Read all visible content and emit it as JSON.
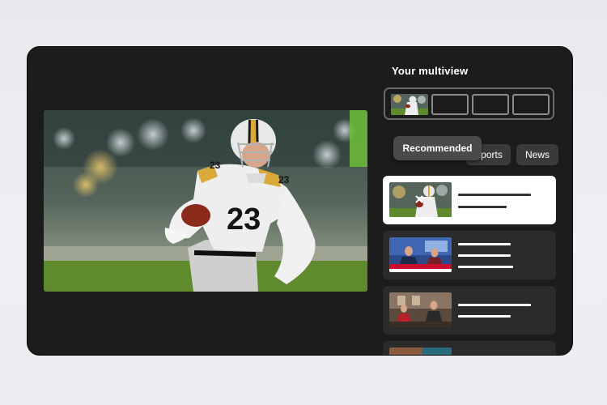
{
  "multiview": {
    "title": "Your multiview",
    "slots": [
      "filled",
      "empty",
      "empty",
      "empty"
    ]
  },
  "main_video": {
    "player_number": "23"
  },
  "tabs": [
    {
      "label": "Sports"
    },
    {
      "label": "News"
    }
  ],
  "tooltip": {
    "label": "Recommended"
  },
  "cards": [
    {
      "kind": "football",
      "selected": true,
      "icon": "close-icon"
    },
    {
      "kind": "news-anchors",
      "selected": false
    },
    {
      "kind": "talk-show",
      "selected": false
    },
    {
      "kind": "partial",
      "selected": false
    }
  ],
  "colors": {
    "frame": "#1c1c1c",
    "card": "#2b2b2b",
    "card_selected": "#ffffff",
    "tab": "#3a3a3a",
    "tooltip": "#4a4a4a"
  }
}
